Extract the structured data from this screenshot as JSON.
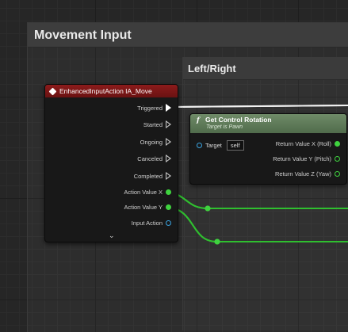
{
  "comments": {
    "outer_title": "Movement Input",
    "inner_title": "Left/Right"
  },
  "event_node": {
    "title": "EnhancedInputAction IA_Move",
    "pins": {
      "triggered": "Triggered",
      "started": "Started",
      "ongoing": "Ongoing",
      "canceled": "Canceled",
      "completed": "Completed",
      "action_value_x": "Action Value X",
      "action_value_y": "Action Value Y",
      "input_action": "Input Action"
    },
    "expand_icon": "chevron-down-icon",
    "header_color": "#7d1717"
  },
  "get_control_rotation": {
    "title": "Get Control Rotation",
    "subtitle": "Target is Pawn",
    "function_icon": "f",
    "target_label": "Target",
    "target_value": "self",
    "outputs": {
      "x": "Return Value X (Roll)",
      "y": "Return Value Y (Pitch)",
      "z": "Return Value Z (Yaw)"
    },
    "header_color": "#5f7a59"
  },
  "colors": {
    "float_pin": "#3fd33f",
    "object_pin": "#3aa3e0",
    "exec_pin": "#ffffff"
  }
}
